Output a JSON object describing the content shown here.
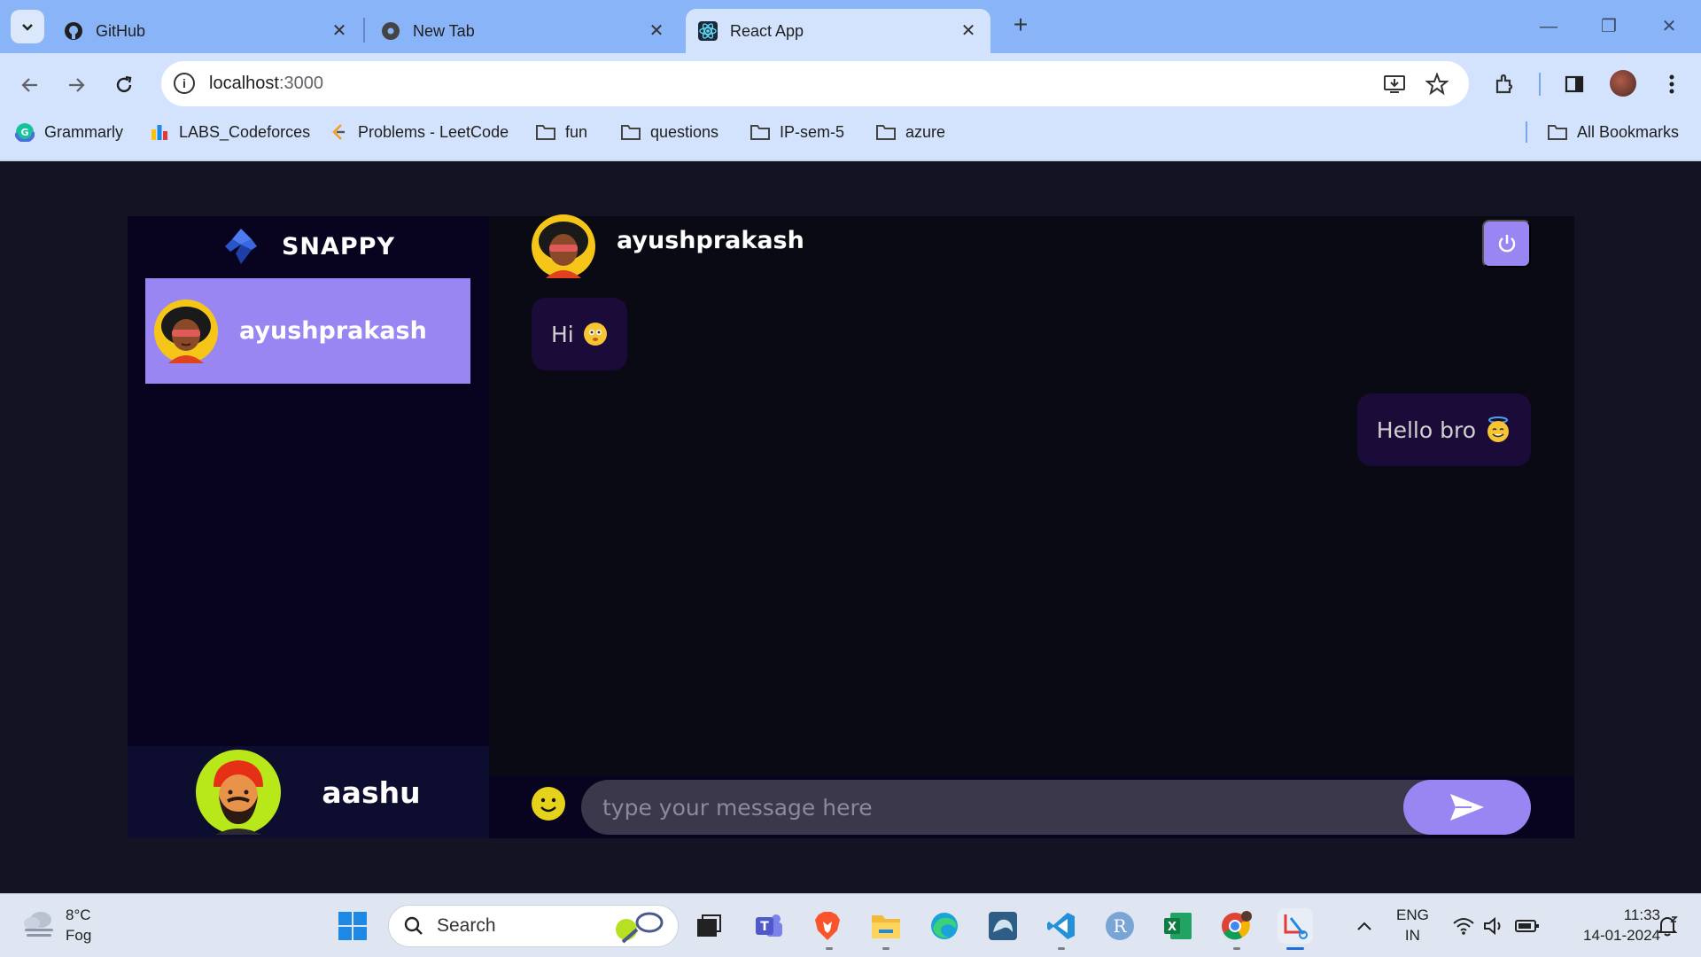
{
  "browser": {
    "tabs": [
      {
        "title": "GitHub",
        "icon": "github-icon"
      },
      {
        "title": "New Tab",
        "icon": "chrome-icon"
      },
      {
        "title": "React App",
        "icon": "react-icon",
        "active": true
      }
    ],
    "url": {
      "host": "localhost",
      "port": ":3000"
    },
    "bookmarks": [
      {
        "label": "Grammarly",
        "icon": "grammarly-icon"
      },
      {
        "label": "LABS_Codeforces",
        "icon": "codeforces-icon"
      },
      {
        "label": "Problems - LeetCode",
        "icon": "leetcode-icon"
      },
      {
        "label": "fun",
        "icon": "folder-icon"
      },
      {
        "label": "questions",
        "icon": "folder-icon"
      },
      {
        "label": "IP-sem-5",
        "icon": "folder-icon"
      },
      {
        "label": "azure",
        "icon": "folder-icon"
      }
    ],
    "all_bookmarks": "All Bookmarks"
  },
  "app": {
    "brand": "SNAPPY",
    "colors": {
      "accent": "#9a86f3",
      "background": "#131324",
      "sidebar": "#080420"
    },
    "contacts": [
      {
        "name": "ayushprakash",
        "selected": true
      }
    ],
    "current_user": {
      "name": "aashu"
    },
    "chat": {
      "title": "ayushprakash",
      "messages": [
        {
          "text": "Hi",
          "direction": "received",
          "emoji": "smiling-face-emoji"
        },
        {
          "text": "Hello bro",
          "direction": "sent",
          "emoji": "halo-face-emoji"
        }
      ],
      "input_placeholder": "type your message here"
    }
  },
  "taskbar": {
    "weather": {
      "temp": "8°C",
      "condition": "Fog"
    },
    "search_label": "Search",
    "language": {
      "lang": "ENG",
      "region": "IN"
    },
    "clock": {
      "time": "11:33",
      "date": "14-01-2024"
    }
  }
}
